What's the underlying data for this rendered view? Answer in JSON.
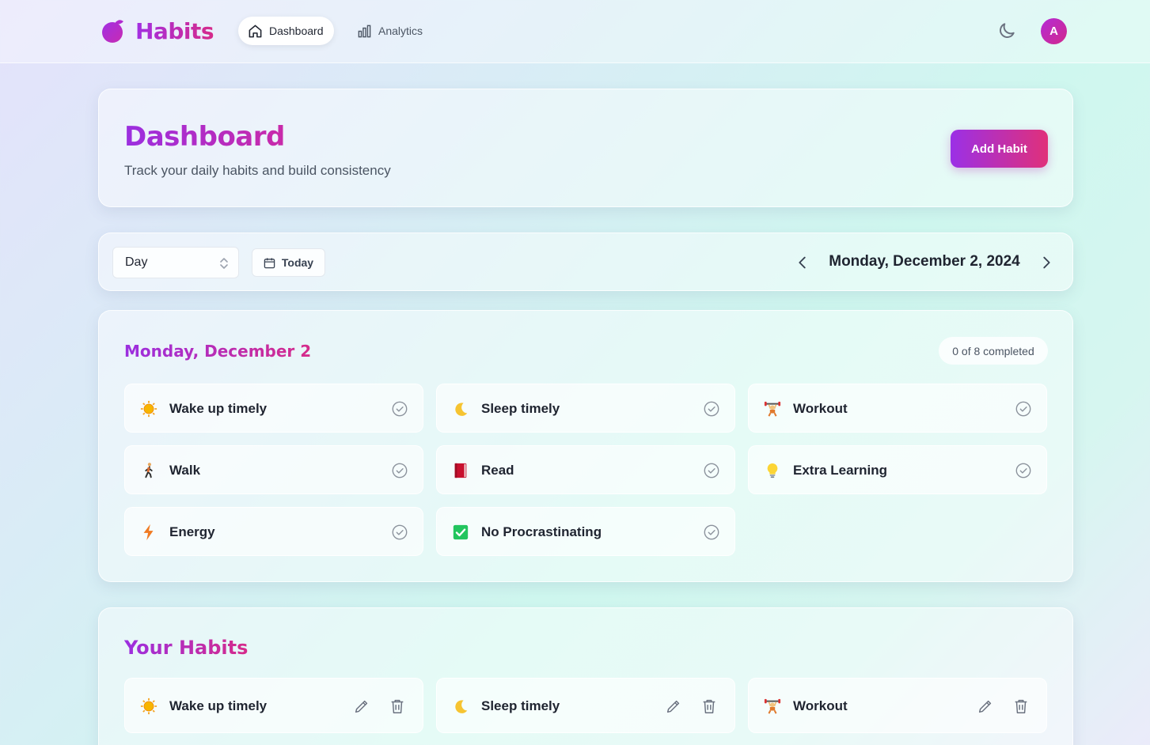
{
  "app": {
    "name": "Habits",
    "avatar_letter": "A",
    "accent": "#a22ee3",
    "accent_end": "#d62b8a"
  },
  "nav": {
    "items": [
      {
        "label": "Dashboard",
        "icon": "home-icon",
        "active": true
      },
      {
        "label": "Analytics",
        "icon": "bar-chart-icon",
        "active": false
      }
    ]
  },
  "header": {
    "title": "Dashboard",
    "subtitle": "Track your daily habits and build consistency",
    "add_button_label": "Add Habit"
  },
  "toolbar": {
    "view_select": {
      "value": "Day"
    },
    "today_label": "Today",
    "current_date": "Monday, December 2, 2024"
  },
  "day": {
    "title": "Monday, December 2",
    "completed_label": "0 of 8 completed",
    "habits": [
      {
        "name": "Wake up timely",
        "icon": "sun-icon",
        "done": false
      },
      {
        "name": "Sleep timely",
        "icon": "moon-icon",
        "done": false
      },
      {
        "name": "Workout",
        "icon": "weightlifter-icon",
        "done": false
      },
      {
        "name": "Walk",
        "icon": "walking-person-icon",
        "done": false
      },
      {
        "name": "Read",
        "icon": "book-icon",
        "done": false
      },
      {
        "name": "Extra Learning",
        "icon": "lightbulb-icon",
        "done": false
      },
      {
        "name": "Energy",
        "icon": "lightning-icon",
        "done": false
      },
      {
        "name": "No Procrastinating",
        "icon": "check-box-icon",
        "done": false
      }
    ]
  },
  "your_habits": {
    "title": "Your Habits",
    "items": [
      {
        "name": "Wake up timely",
        "icon": "sun-icon"
      },
      {
        "name": "Sleep timely",
        "icon": "moon-icon"
      },
      {
        "name": "Workout",
        "icon": "weightlifter-icon"
      }
    ]
  }
}
